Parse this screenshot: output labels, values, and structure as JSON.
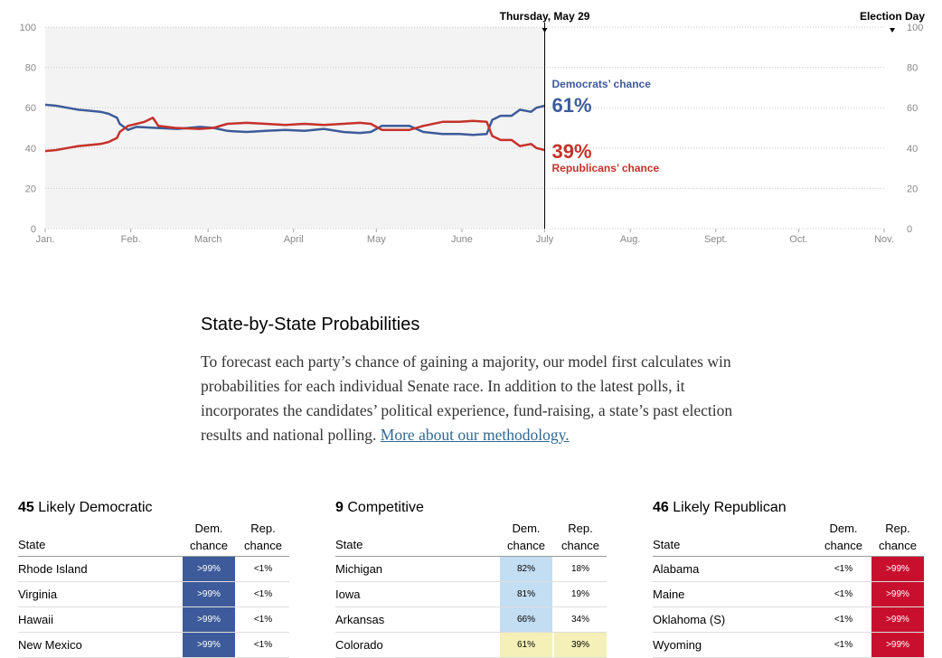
{
  "chart_data": {
    "type": "line",
    "x_ticks": [
      "Jan.",
      "Feb.",
      "March",
      "April",
      "May",
      "June",
      "July",
      "Aug.",
      "Sept.",
      "Oct.",
      "Nov."
    ],
    "y_ticks": [
      0,
      20,
      40,
      60,
      80,
      100
    ],
    "ylim": [
      0,
      100
    ],
    "current_marker": "Thursday, May 29",
    "end_marker": "Election Day",
    "series": [
      {
        "name": "Democrats’ chance",
        "color": "#3d5b9a",
        "current_value": "61%",
        "points": [
          [
            "2014-01-01",
            61.5
          ],
          [
            "2014-01-05",
            61
          ],
          [
            "2014-01-09",
            60
          ],
          [
            "2014-01-13",
            59
          ],
          [
            "2014-01-17",
            58.5
          ],
          [
            "2014-01-21",
            58
          ],
          [
            "2014-01-24",
            57
          ],
          [
            "2014-01-27",
            55
          ],
          [
            "2014-01-28",
            52
          ],
          [
            "2014-01-31",
            49
          ],
          [
            "2014-02-03",
            50.5
          ],
          [
            "2014-02-10",
            50
          ],
          [
            "2014-02-18",
            49.5
          ],
          [
            "2014-02-26",
            50.5
          ],
          [
            "2014-03-03",
            50
          ],
          [
            "2014-03-08",
            48.5
          ],
          [
            "2014-03-15",
            48
          ],
          [
            "2014-03-22",
            48.5
          ],
          [
            "2014-03-29",
            49
          ],
          [
            "2014-04-05",
            48.5
          ],
          [
            "2014-04-12",
            49.5
          ],
          [
            "2014-04-19",
            48
          ],
          [
            "2014-04-25",
            47.5
          ],
          [
            "2014-04-29",
            48
          ],
          [
            "2014-05-03",
            51
          ],
          [
            "2014-05-08",
            51
          ],
          [
            "2014-05-13",
            51
          ],
          [
            "2014-05-18",
            48
          ],
          [
            "2014-05-25",
            47
          ],
          [
            "2014-05-31",
            47
          ],
          [
            "2014-06-05",
            46.5
          ],
          [
            "2014-06-10",
            47
          ],
          [
            "2014-06-12",
            54
          ],
          [
            "2014-06-15",
            56
          ],
          [
            "2014-06-19",
            56
          ],
          [
            "2014-06-22",
            59
          ],
          [
            "2014-06-26",
            58
          ],
          [
            "2014-06-28",
            60
          ],
          [
            "2014-07-01",
            61
          ]
        ]
      },
      {
        "name": "Republicans’ chance",
        "color": "#c4322b",
        "current_value": "39%",
        "points": [
          [
            "2014-01-01",
            38.5
          ],
          [
            "2014-01-05",
            39
          ],
          [
            "2014-01-09",
            40
          ],
          [
            "2014-01-13",
            41
          ],
          [
            "2014-01-17",
            41.5
          ],
          [
            "2014-01-21",
            42
          ],
          [
            "2014-01-24",
            43
          ],
          [
            "2014-01-27",
            45
          ],
          [
            "2014-01-28",
            48
          ],
          [
            "2014-01-31",
            51
          ],
          [
            "2014-02-06",
            53
          ],
          [
            "2014-02-09",
            55
          ],
          [
            "2014-02-11",
            51
          ],
          [
            "2014-02-17",
            50
          ],
          [
            "2014-02-26",
            49.5
          ],
          [
            "2014-03-03",
            50
          ],
          [
            "2014-03-08",
            52
          ],
          [
            "2014-03-15",
            52.5
          ],
          [
            "2014-03-22",
            52
          ],
          [
            "2014-03-29",
            51.5
          ],
          [
            "2014-04-05",
            52
          ],
          [
            "2014-04-12",
            51.5
          ],
          [
            "2014-04-19",
            52
          ],
          [
            "2014-04-25",
            52.5
          ],
          [
            "2014-04-29",
            52
          ],
          [
            "2014-05-03",
            49
          ],
          [
            "2014-05-08",
            49
          ],
          [
            "2014-05-13",
            49
          ],
          [
            "2014-05-18",
            51
          ],
          [
            "2014-05-25",
            53
          ],
          [
            "2014-05-31",
            53
          ],
          [
            "2014-06-05",
            53.5
          ],
          [
            "2014-06-10",
            53
          ],
          [
            "2014-06-12",
            46
          ],
          [
            "2014-06-15",
            44
          ],
          [
            "2014-06-19",
            44
          ],
          [
            "2014-06-22",
            41
          ],
          [
            "2014-06-26",
            42
          ],
          [
            "2014-06-28",
            40
          ],
          [
            "2014-07-01",
            39
          ]
        ]
      }
    ]
  },
  "intro": {
    "heading": "State-by-State Probabilities",
    "body": "To forecast each party’s chance of gaining a majority, our model first calculates win probabilities for each individual Senate race. In addition to the latest polls, it incorporates the candidates’ political experience, fund-raising, a state’s past election results and national polling. ",
    "link": "More about our methodology."
  },
  "columns": {
    "state": "State",
    "dem": [
      "Dem.",
      "chance"
    ],
    "rep": [
      "Rep.",
      "chance"
    ]
  },
  "tables": [
    {
      "count": "45",
      "label": "Likely Democratic",
      "rows": [
        {
          "state": "Rhode Island",
          "dem": ">99%",
          "rep": "<1%",
          "dem_bg": "#3d5b9a",
          "dem_fg": "#ffffff",
          "rep_bg": "#ffffff",
          "rep_fg": "#000000"
        },
        {
          "state": "Virginia",
          "dem": ">99%",
          "rep": "<1%",
          "dem_bg": "#3d5b9a",
          "dem_fg": "#ffffff",
          "rep_bg": "#ffffff",
          "rep_fg": "#000000"
        },
        {
          "state": "Hawaii",
          "dem": ">99%",
          "rep": "<1%",
          "dem_bg": "#3d5b9a",
          "dem_fg": "#ffffff",
          "rep_bg": "#ffffff",
          "rep_fg": "#000000"
        },
        {
          "state": "New Mexico",
          "dem": ">99%",
          "rep": "<1%",
          "dem_bg": "#3d5b9a",
          "dem_fg": "#ffffff",
          "rep_bg": "#ffffff",
          "rep_fg": "#000000"
        }
      ]
    },
    {
      "count": "9",
      "label": "Competitive",
      "rows": [
        {
          "state": "Michigan",
          "dem": "82%",
          "rep": "18%",
          "dem_bg": "#c3ddf2",
          "dem_fg": "#000000",
          "rep_bg": "#ffffff",
          "rep_fg": "#000000"
        },
        {
          "state": "Iowa",
          "dem": "81%",
          "rep": "19%",
          "dem_bg": "#c3ddf2",
          "dem_fg": "#000000",
          "rep_bg": "#ffffff",
          "rep_fg": "#000000"
        },
        {
          "state": "Arkansas",
          "dem": "66%",
          "rep": "34%",
          "dem_bg": "#c3ddf2",
          "dem_fg": "#000000",
          "rep_bg": "#ffffff",
          "rep_fg": "#000000"
        },
        {
          "state": "Colorado",
          "dem": "61%",
          "rep": "39%",
          "dem_bg": "#f5f0b8",
          "dem_fg": "#000000",
          "rep_bg": "#f5f0b8",
          "rep_fg": "#000000"
        }
      ]
    },
    {
      "count": "46",
      "label": "Likely Republican",
      "rows": [
        {
          "state": "Alabama",
          "dem": "<1%",
          "rep": ">99%",
          "dem_bg": "#ffffff",
          "dem_fg": "#000000",
          "rep_bg": "#c8102e",
          "rep_fg": "#ffffff"
        },
        {
          "state": "Maine",
          "dem": "<1%",
          "rep": ">99%",
          "dem_bg": "#ffffff",
          "dem_fg": "#000000",
          "rep_bg": "#c8102e",
          "rep_fg": "#ffffff"
        },
        {
          "state": "Oklahoma (S)",
          "dem": "<1%",
          "rep": ">99%",
          "dem_bg": "#ffffff",
          "dem_fg": "#000000",
          "rep_bg": "#c8102e",
          "rep_fg": "#ffffff"
        },
        {
          "state": "Wyoming",
          "dem": "<1%",
          "rep": ">99%",
          "dem_bg": "#ffffff",
          "dem_fg": "#000000",
          "rep_bg": "#c8102e",
          "rep_fg": "#ffffff"
        }
      ]
    }
  ]
}
